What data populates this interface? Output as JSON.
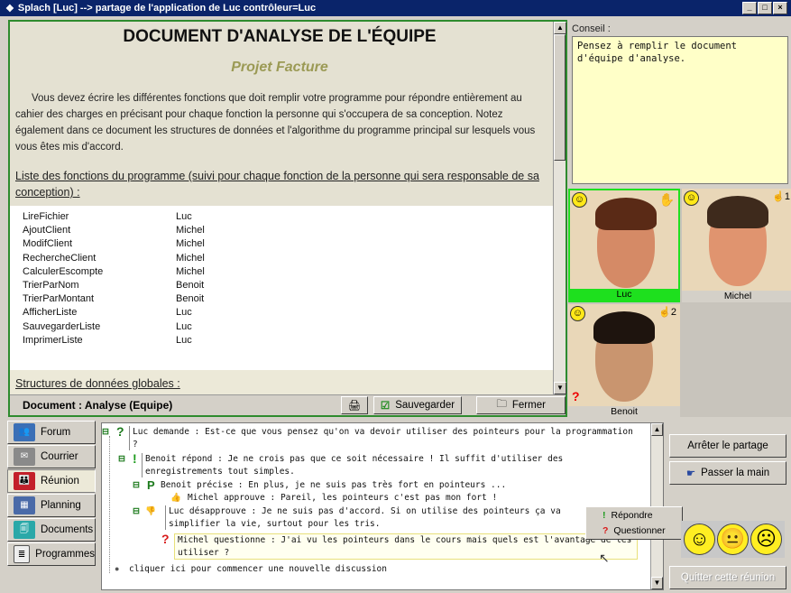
{
  "window": {
    "title": "Splach [Luc] --> partage de l'application de Luc contrôleur=Luc"
  },
  "document": {
    "title": "DOCUMENT D'ANALYSE DE L'ÉQUIPE",
    "subtitle": "Projet Facture",
    "intro": "Vous devez écrire les différentes fonctions que doit remplir votre programme pour répondre entièrement au cahier des charges en précisant pour chaque fonction la personne qui s'occupera de sa conception. Notez également dans ce document les structures de données et l'algorithme du programme principal sur lesquels vous vous êtes mis d'accord.",
    "functions_heading": "Liste des fonctions du programme (suivi pour chaque fonction de la personne qui sera responsable de sa conception) :",
    "functions": [
      {
        "name": "LireFichier",
        "owner": "Luc"
      },
      {
        "name": "AjoutClient",
        "owner": "Michel"
      },
      {
        "name": "ModifClient",
        "owner": "Michel"
      },
      {
        "name": "RechercheClient",
        "owner": "Michel"
      },
      {
        "name": "CalculerEscompte",
        "owner": "Michel"
      },
      {
        "name": "TrierParNom",
        "owner": "Benoit"
      },
      {
        "name": "TrierParMontant",
        "owner": "Benoit"
      },
      {
        "name": "AfficherListe",
        "owner": "Luc"
      },
      {
        "name": "SauvegarderListe",
        "owner": "Luc"
      },
      {
        "name": "ImprimerListe",
        "owner": "Luc"
      }
    ],
    "structures_heading": "Structures de données globales :",
    "status_label": "Document : Analyse (Equipe)",
    "save_label": "Sauvegarder",
    "close_label": "Fermer"
  },
  "conseil": {
    "label": "Conseil :",
    "text": "Pensez à remplir le document d'équipe d'analyse."
  },
  "participants": [
    {
      "name": "Luc",
      "hand": ""
    },
    {
      "name": "Michel",
      "hand": "1"
    },
    {
      "name": "Benoit",
      "hand": "2"
    }
  ],
  "sidebar": {
    "items": [
      {
        "label": "Forum"
      },
      {
        "label": "Courrier"
      },
      {
        "label": "Réunion"
      },
      {
        "label": "Planning"
      },
      {
        "label": "Documents"
      },
      {
        "label": "Programmes"
      }
    ]
  },
  "thread": {
    "messages": [
      {
        "text": "Luc demande : Est-ce que vous pensez qu'on va devoir utiliser des pointeurs pour la programmation ?"
      },
      {
        "text": "Benoit répond : Je ne crois pas que ce soit nécessaire ! Il suffit d'utiliser des enregistrements tout simples."
      },
      {
        "text": "Benoit précise : En plus, je ne suis pas très fort en pointeurs ..."
      },
      {
        "text": "Michel approuve : Pareil, les pointeurs c'est pas mon fort !"
      },
      {
        "text": "Luc désapprouve : Je ne suis pas d'accord. Si on utilise des pointeurs ça va simplifier la vie, surtout pour les tris."
      },
      {
        "text": "Michel questionne : J'ai vu les pointeurs dans le cours mais quels est l'avantage de les utiliser ?"
      },
      {
        "text": "cliquer ici pour commencer une nouvelle discussion"
      }
    ]
  },
  "context_menu": {
    "reply": "Répondre",
    "question": "Questionner"
  },
  "actions": {
    "stop_share": "Arrêter le partage",
    "pass_hand": "Passer la main",
    "quit": "Quitter cette réunion"
  }
}
